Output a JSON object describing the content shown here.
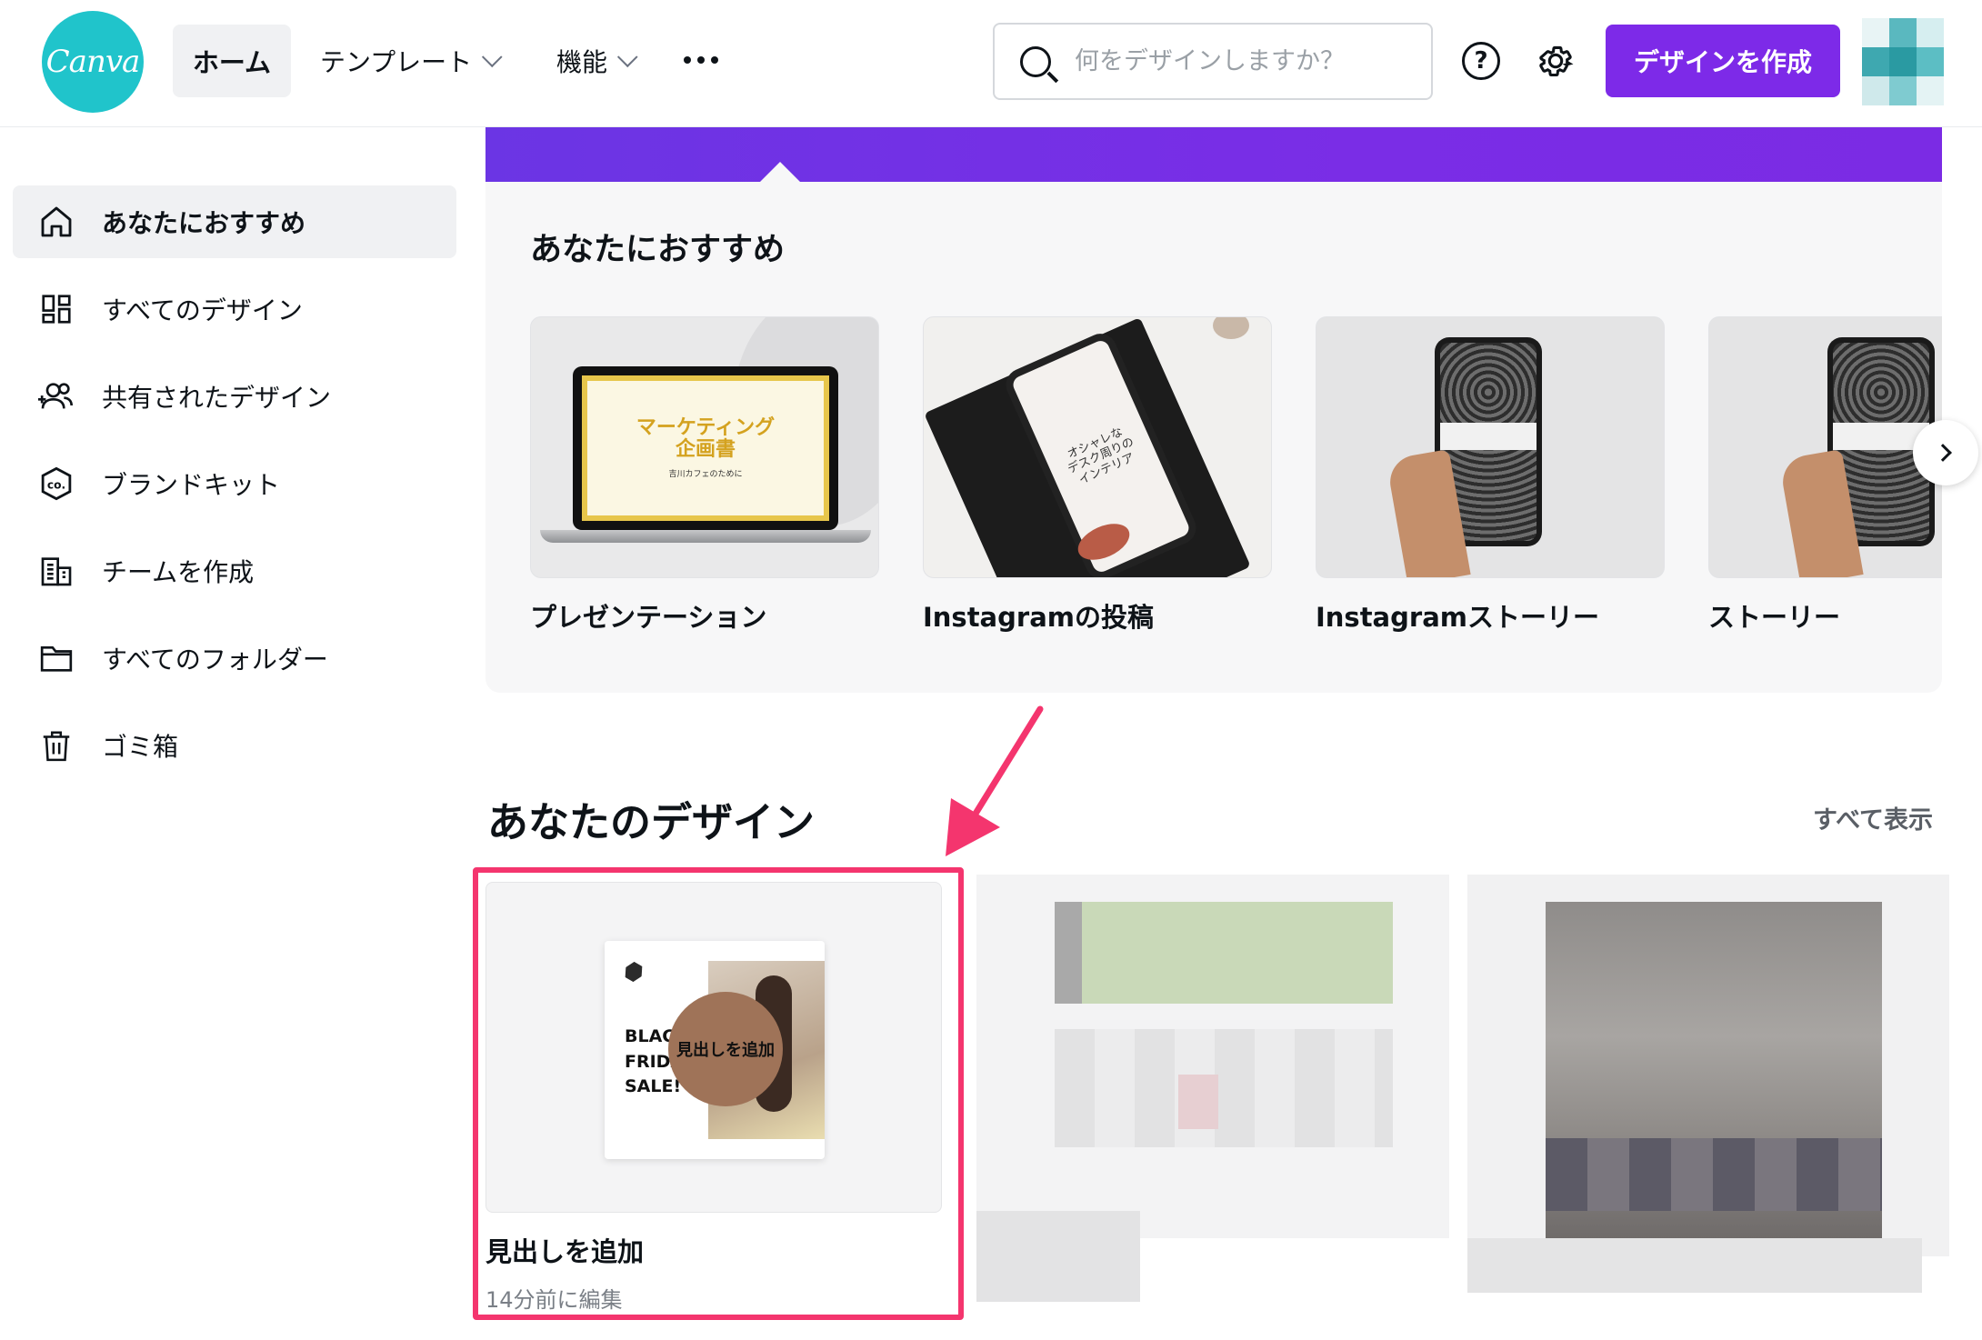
{
  "header": {
    "logo_text": "Canva",
    "nav_home": "ホーム",
    "nav_templates": "テンプレート",
    "nav_features": "機能",
    "search_placeholder": "何をデザインしますか？",
    "create_button": "デザインを作成"
  },
  "sidebar": {
    "items": [
      {
        "label": "あなたにおすすめ",
        "icon": "home-icon"
      },
      {
        "label": "すべてのデザイン",
        "icon": "grid-icon"
      },
      {
        "label": "共有されたデザイン",
        "icon": "people-icon"
      },
      {
        "label": "ブランドキット",
        "icon": "brand-kit-icon"
      },
      {
        "label": "チームを作成",
        "icon": "building-icon"
      },
      {
        "label": "すべてのフォルダー",
        "icon": "folder-icon"
      },
      {
        "label": "ゴミ箱",
        "icon": "trash-icon"
      }
    ]
  },
  "recommend": {
    "title": "あなたにおすすめ",
    "cards": [
      {
        "label": "プレゼンテーション",
        "thumb_title": "マーケティング\n企画書",
        "thumb_sub": "吉川カフェのために"
      },
      {
        "label": "Instagramの投稿",
        "thumb_title": "オシャレな\nデスク周りの\nインテリア"
      },
      {
        "label": "Instagramストーリー"
      },
      {
        "label": "ストーリー"
      }
    ]
  },
  "designs": {
    "title": "あなたのデザイン",
    "show_all": "すべて表示",
    "items": [
      {
        "title": "見出しを追加",
        "meta": "14分前に編集",
        "thumb_text": "BLACK FRIDAY SALE!",
        "thumb_overlay": "見出しを追加"
      }
    ]
  },
  "colors": {
    "brand_purple": "#7d2ae8",
    "canva_teal": "#20c4cb",
    "highlight_pink": "#f4356e"
  }
}
